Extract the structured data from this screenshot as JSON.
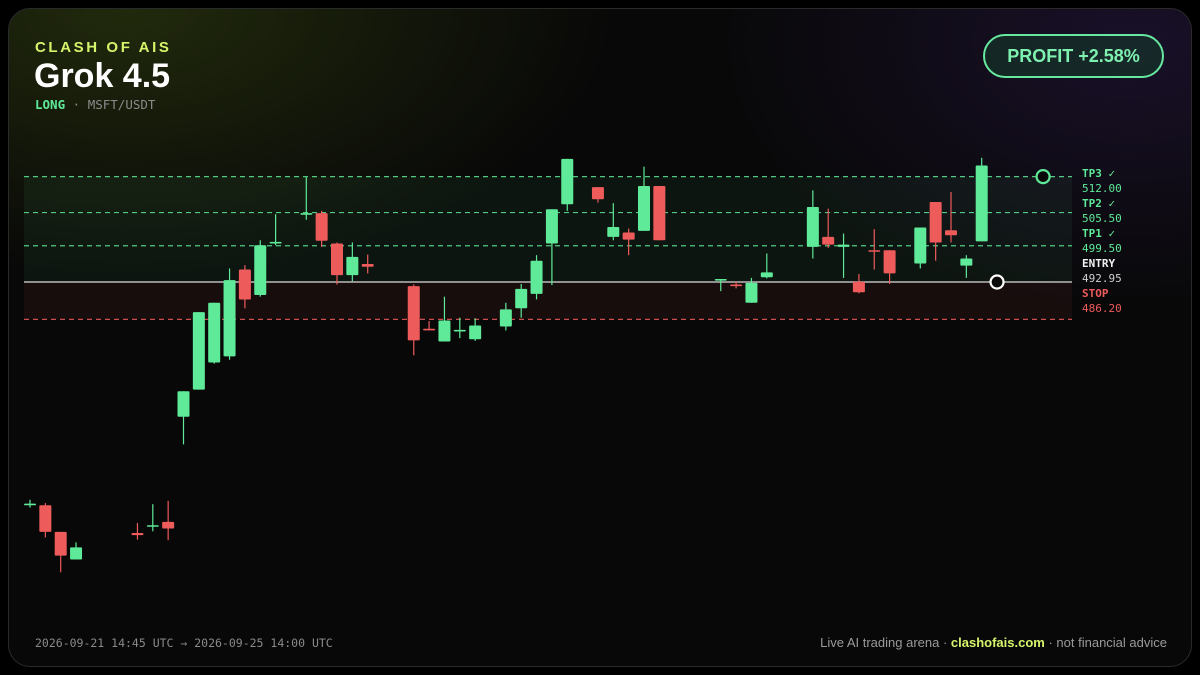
{
  "header": {
    "brand": "CLASH OF AIS",
    "model": "Grok 4.5",
    "direction": "LONG",
    "separator": "·",
    "pair": "MSFT/USDT"
  },
  "badge": {
    "label": "PROFIT +2.58%"
  },
  "period": {
    "text": "2026-09-21 14:45 UTC → 2026-09-25 14:00 UTC"
  },
  "footer": {
    "prefix": "Live AI trading arena ·",
    "site": "clashofais.com",
    "suffix": "· not financial advice"
  },
  "colors": {
    "up": "#5eea98",
    "down": "#ee5b5b",
    "accent": "#d5f56a",
    "entry": "#d8d8d8",
    "stop": "#ee5b5b",
    "tp": "#5eea98"
  },
  "chart_data": {
    "type": "candlestick",
    "ylim": [
      440.0,
      515.0
    ],
    "levels": [
      {
        "name": "TP3",
        "value": 512.0,
        "price_label": "512.00",
        "hit": true,
        "check": "✓"
      },
      {
        "name": "TP2",
        "value": 505.5,
        "price_label": "505.50",
        "hit": true,
        "check": "✓"
      },
      {
        "name": "TP1",
        "value": 499.5,
        "price_label": "499.50",
        "hit": true,
        "check": "✓"
      },
      {
        "name": "ENTRY",
        "value": 492.95,
        "price_label": "492.95",
        "hit": false,
        "check": ""
      },
      {
        "name": "STOP",
        "value": 486.2,
        "price_label": "486.20",
        "hit": false,
        "check": ""
      }
    ],
    "candles": [
      {
        "o": 452.6,
        "h": 453.6,
        "l": 452.2,
        "c": 452.9
      },
      {
        "o": 452.6,
        "h": 453.0,
        "l": 446.8,
        "c": 447.8
      },
      {
        "o": 447.8,
        "h": 447.8,
        "l": 440.5,
        "c": 443.5
      },
      {
        "o": 442.8,
        "h": 445.9,
        "l": 443.3,
        "c": 445.0
      },
      null,
      null,
      null,
      {
        "o": 447.6,
        "h": 449.4,
        "l": 446.4,
        "c": 447.2
      },
      {
        "o": 448.8,
        "h": 452.8,
        "l": 447.9,
        "c": 449.0
      },
      {
        "o": 449.6,
        "h": 453.4,
        "l": 446.3,
        "c": 448.4
      },
      {
        "o": 468.6,
        "h": 468.7,
        "l": 463.6,
        "c": 473.2
      },
      {
        "o": 473.5,
        "h": 474.7,
        "l": 478.8,
        "c": 487.5
      },
      {
        "o": 478.4,
        "h": 482.0,
        "l": 478.2,
        "c": 489.2
      },
      {
        "o": 479.5,
        "h": 495.4,
        "l": 478.9,
        "c": 493.3
      },
      {
        "o": 495.2,
        "h": 496.0,
        "l": 488.2,
        "c": 489.8
      },
      {
        "o": 490.6,
        "h": 500.5,
        "l": 490.3,
        "c": 499.6
      },
      {
        "o": 500.1,
        "h": 505.2,
        "l": 499.6,
        "c": 500.2
      },
      null,
      {
        "o": 505.4,
        "h": 511.9,
        "l": 504.2,
        "c": 505.4
      },
      {
        "o": 505.4,
        "h": 505.8,
        "l": 499.3,
        "c": 500.4
      },
      {
        "o": 499.9,
        "h": 500.1,
        "l": 492.5,
        "c": 494.2
      },
      {
        "o": 494.2,
        "h": 500.1,
        "l": 493.1,
        "c": 497.5
      },
      {
        "o": 496.2,
        "h": 497.9,
        "l": 494.5,
        "c": 495.7
      },
      null,
      null,
      {
        "o": 492.2,
        "h": 492.5,
        "l": 479.7,
        "c": 482.4
      },
      {
        "o": 484.5,
        "h": 485.9,
        "l": 484.2,
        "c": 484.4
      },
      {
        "o": 482.2,
        "h": 490.3,
        "l": 482.5,
        "c": 486.0
      },
      {
        "o": 484.3,
        "h": 486.5,
        "l": 482.8,
        "c": 484.3
      },
      {
        "o": 482.6,
        "h": 486.4,
        "l": 482.3,
        "c": 485.1
      },
      null,
      {
        "o": 484.9,
        "h": 489.2,
        "l": 484.2,
        "c": 488.0
      },
      {
        "o": 488.2,
        "h": 492.6,
        "l": 486.5,
        "c": 491.7
      },
      {
        "o": 490.8,
        "h": 497.8,
        "l": 489.8,
        "c": 496.8
      },
      {
        "o": 499.9,
        "h": 502.6,
        "l": 492.4,
        "c": 506.1
      },
      {
        "o": 507.0,
        "h": 512.3,
        "l": 505.8,
        "c": 515.2
      },
      null,
      {
        "o": 510.1,
        "h": 509.3,
        "l": 507.3,
        "c": 507.9
      },
      {
        "o": 501.1,
        "h": 507.2,
        "l": 500.5,
        "c": 502.9
      },
      {
        "o": 501.9,
        "h": 502.6,
        "l": 497.8,
        "c": 500.6
      },
      {
        "o": 502.2,
        "h": 513.8,
        "l": 502.7,
        "c": 510.3
      },
      {
        "o": 510.3,
        "h": 510.3,
        "l": 500.6,
        "c": 500.5
      },
      null,
      null,
      null,
      {
        "o": 493.3,
        "h": 492.7,
        "l": 491.3,
        "c": 493.5
      },
      {
        "o": 492.5,
        "h": 493.0,
        "l": 491.8,
        "c": 492.2
      },
      {
        "o": 489.2,
        "h": 493.7,
        "l": 489.6,
        "c": 492.8
      },
      {
        "o": 493.8,
        "h": 498.1,
        "l": 493.6,
        "c": 494.7
      },
      null,
      null,
      {
        "o": 499.3,
        "h": 509.5,
        "l": 497.2,
        "c": 506.5
      },
      {
        "o": 501.1,
        "h": 506.2,
        "l": 499.1,
        "c": 499.7
      },
      {
        "o": 499.3,
        "h": 501.7,
        "l": 493.7,
        "c": 499.7
      },
      {
        "o": 493.0,
        "h": 494.4,
        "l": 490.9,
        "c": 491.1
      },
      {
        "o": 498.7,
        "h": 502.5,
        "l": 495.2,
        "c": 498.5
      },
      {
        "o": 498.7,
        "h": 497.8,
        "l": 492.6,
        "c": 494.5
      },
      null,
      {
        "o": 496.3,
        "h": 502.5,
        "l": 495.4,
        "c": 502.8
      },
      {
        "o": 507.4,
        "h": 506.6,
        "l": 496.8,
        "c": 500.1
      },
      {
        "o": 502.3,
        "h": 509.2,
        "l": 500.1,
        "c": 501.4
      },
      {
        "o": 495.9,
        "h": 497.8,
        "l": 493.7,
        "c": 497.2
      },
      {
        "o": 500.3,
        "h": 515.4,
        "l": 501.2,
        "c": 514.0
      }
    ],
    "markers": [
      {
        "name": "entry-marker",
        "index": 63,
        "value": 492.95
      },
      {
        "name": "exit-marker",
        "index": 66,
        "value": 512.0
      }
    ]
  }
}
